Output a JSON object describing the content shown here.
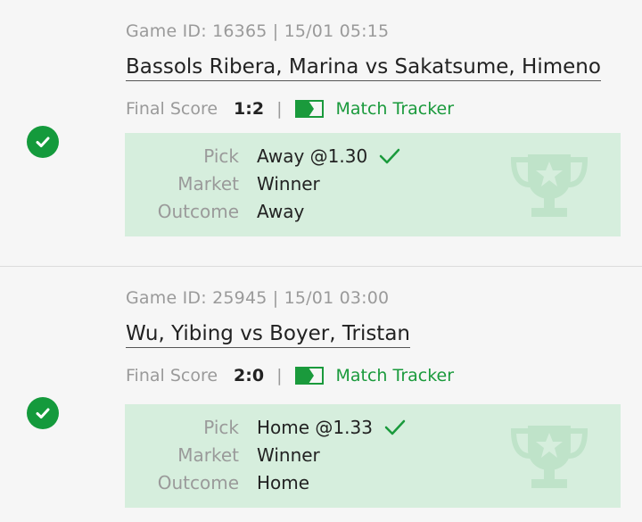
{
  "colors": {
    "accent": "#1a9a3c",
    "pick_bg": "#d6eedd",
    "trophy": "#bfe3c9"
  },
  "bets": [
    {
      "game_meta": "Game ID: 16365 | 15/01 05:15",
      "match": "Bassols Ribera, Marina vs Sakatsume, Himeno",
      "final_score_label": "Final Score",
      "final_score": "1:2",
      "separator": "|",
      "tracker_label": "Match Tracker",
      "status_icon": "check-circle-icon",
      "pick_label": "Pick",
      "pick_value": "Away @1.30",
      "market_label": "Market",
      "market_value": "Winner",
      "outcome_label": "Outcome",
      "outcome_value": "Away"
    },
    {
      "game_meta": "Game ID: 25945 | 15/01 03:00",
      "match": "Wu, Yibing vs Boyer, Tristan",
      "final_score_label": "Final Score",
      "final_score": "2:0",
      "separator": "|",
      "tracker_label": "Match Tracker",
      "status_icon": "check-circle-icon",
      "pick_label": "Pick",
      "pick_value": "Home @1.33",
      "market_label": "Market",
      "market_value": "Winner",
      "outcome_label": "Outcome",
      "outcome_value": "Home"
    }
  ]
}
